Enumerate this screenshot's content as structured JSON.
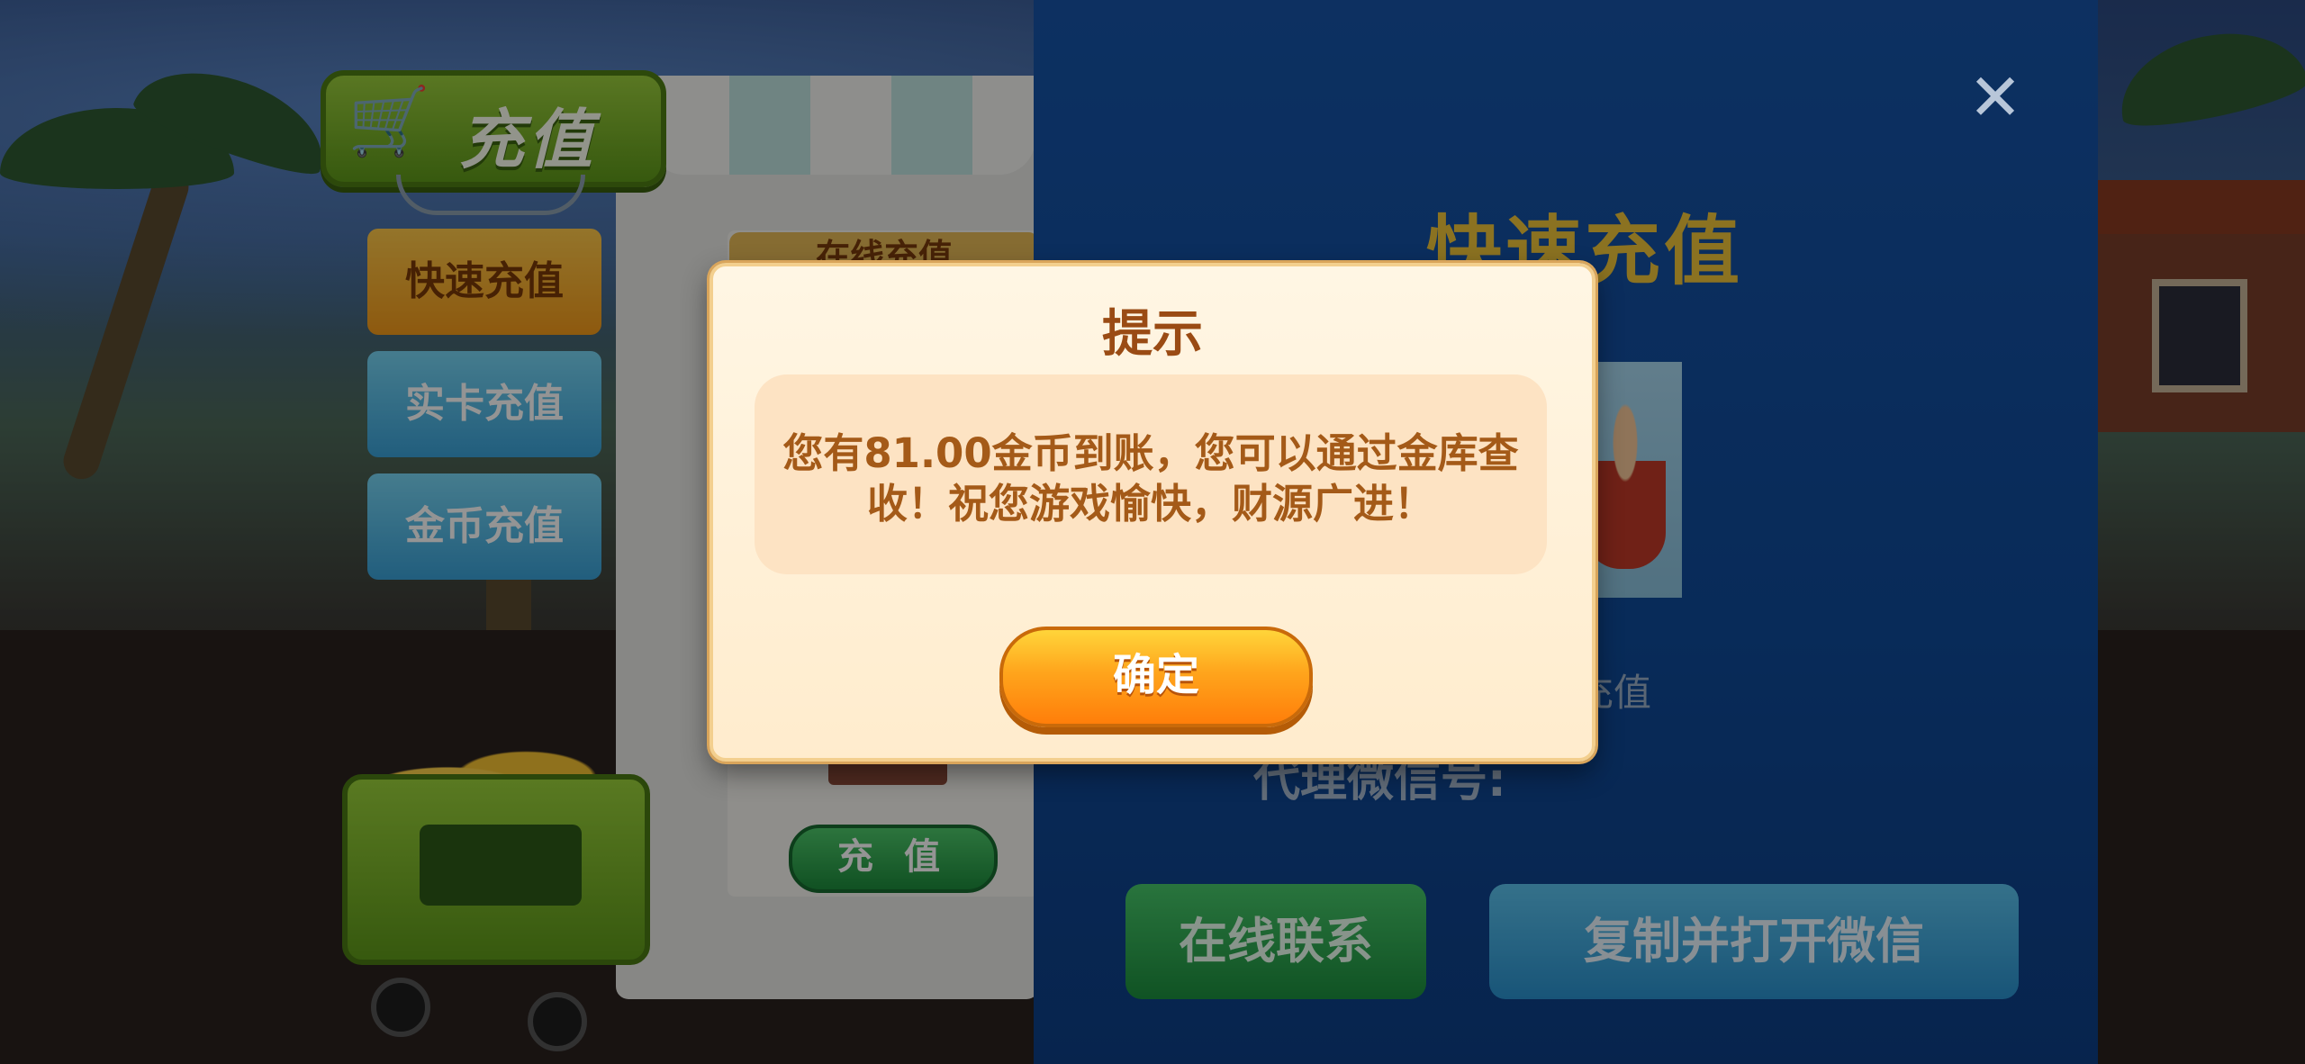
{
  "shop": {
    "sign_title": "充值",
    "stall_tab": "在线充值",
    "stall_button": "充 值",
    "tabs": [
      "快速充值",
      "实卡充值",
      "金币充值"
    ]
  },
  "panel": {
    "close": "✕",
    "title": "快速充值",
    "partial_label": "充值",
    "agent_wechat_label": "代理微信号:",
    "online_contact": "在线联系",
    "copy_open_wechat": "复制并打开微信"
  },
  "dialog": {
    "title": "提示",
    "message_line1": "您有81.00金币到账，您可以通过金库查",
    "message_line2": "收！祝您游戏愉快，财源广进！",
    "ok_label": "确定"
  },
  "colors": {
    "panel_blue": "#1754a8",
    "accent_gold": "#f0c43a",
    "modal_text": "#a45a18",
    "ok_orange": "#ff9a15"
  },
  "icons": [
    "cart-icon",
    "close-icon"
  ]
}
